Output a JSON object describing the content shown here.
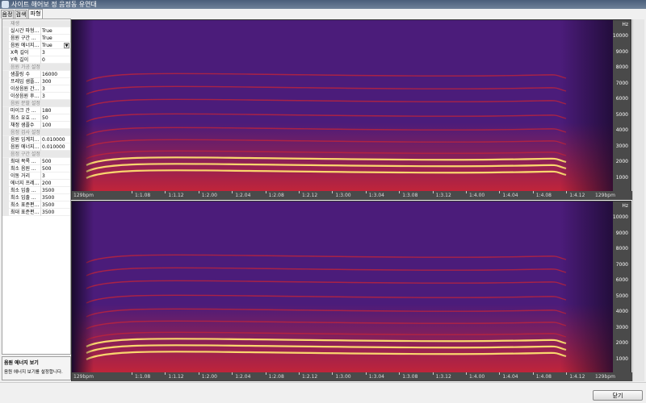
{
  "window": {
    "title": "사이트 해어보 정 음정동 유연대"
  },
  "tabs": [
    {
      "label": "음정",
      "active": false
    },
    {
      "label": "검색",
      "active": false
    },
    {
      "label": "파형",
      "active": true
    }
  ],
  "properties": [
    {
      "kind": "cat",
      "name": "재생"
    },
    {
      "kind": "prop",
      "name": "실시간 파형...",
      "value": "True"
    },
    {
      "kind": "prop",
      "name": "음원 구간 ...",
      "value": "True"
    },
    {
      "kind": "prop",
      "name": "음원 에너지...",
      "value": "True",
      "dropdown": true
    },
    {
      "kind": "prop",
      "name": "X축 길이",
      "value": "3"
    },
    {
      "kind": "prop",
      "name": "Y축 길이",
      "value": "0"
    },
    {
      "kind": "cat",
      "name": "음원 가공 설정"
    },
    {
      "kind": "prop",
      "name": "샘플링 수",
      "value": "16000"
    },
    {
      "kind": "prop",
      "name": "프레임 샘플...",
      "value": "300"
    },
    {
      "kind": "prop",
      "name": "이상음원 간...",
      "value": "3"
    },
    {
      "kind": "prop",
      "name": "이상음원 후...",
      "value": "3"
    },
    {
      "kind": "cat",
      "name": "음원 분할 설정"
    },
    {
      "kind": "prop",
      "name": "마이크 간 ...",
      "value": "180"
    },
    {
      "kind": "prop",
      "name": "최소 유효 ...",
      "value": "50"
    },
    {
      "kind": "prop",
      "name": "채정 샘플수",
      "value": "100"
    },
    {
      "kind": "cat",
      "name": "음정 검사 설정"
    },
    {
      "kind": "prop",
      "name": "음원 임계치...",
      "value": "0.010000"
    },
    {
      "kind": "prop",
      "name": "음원 에너지...",
      "value": "0.010000"
    },
    {
      "kind": "cat",
      "name": "음정 구간 설정"
    },
    {
      "kind": "prop",
      "name": "최대 목록 ...",
      "value": "500"
    },
    {
      "kind": "prop",
      "name": "최소 음원 ...",
      "value": "500"
    },
    {
      "kind": "prop",
      "name": "이동 거리",
      "value": "3"
    },
    {
      "kind": "prop",
      "name": "에너지 프레...",
      "value": "200"
    },
    {
      "kind": "prop",
      "name": "최소 입출 ...",
      "value": "3500"
    },
    {
      "kind": "prop",
      "name": "최소 입출 ...",
      "value": "3500"
    },
    {
      "kind": "prop",
      "name": "최소 표준편...",
      "value": "3500"
    },
    {
      "kind": "prop",
      "name": "최대 표준편...",
      "value": "3500"
    }
  ],
  "description": {
    "title": "음원 에너지 보기",
    "text": "음원 에너지 보기를 설정합니다."
  },
  "spectrogram": {
    "y_unit": "Hz",
    "y_labels": [
      "10000",
      "9000",
      "8000",
      "7000",
      "6000",
      "5000",
      "4000",
      "3000",
      "2000",
      "1000"
    ],
    "x_labels": [
      "129bpm",
      "1:1.08",
      "1:1.12",
      "1:2.00",
      "1:2.04",
      "1:2.08",
      "1:2.12",
      "1:3.00",
      "1:3.04",
      "1:3.08",
      "1:3.12",
      "1:4.00",
      "1:4.04",
      "1:4.08",
      "1:4.12",
      "129bpm"
    ],
    "colors": {
      "background": "#1a0a2e",
      "low": "#4b1c7a",
      "mid": "#c0243a",
      "high": "#ffe070"
    }
  },
  "buttons": {
    "close_label": "닫기"
  }
}
